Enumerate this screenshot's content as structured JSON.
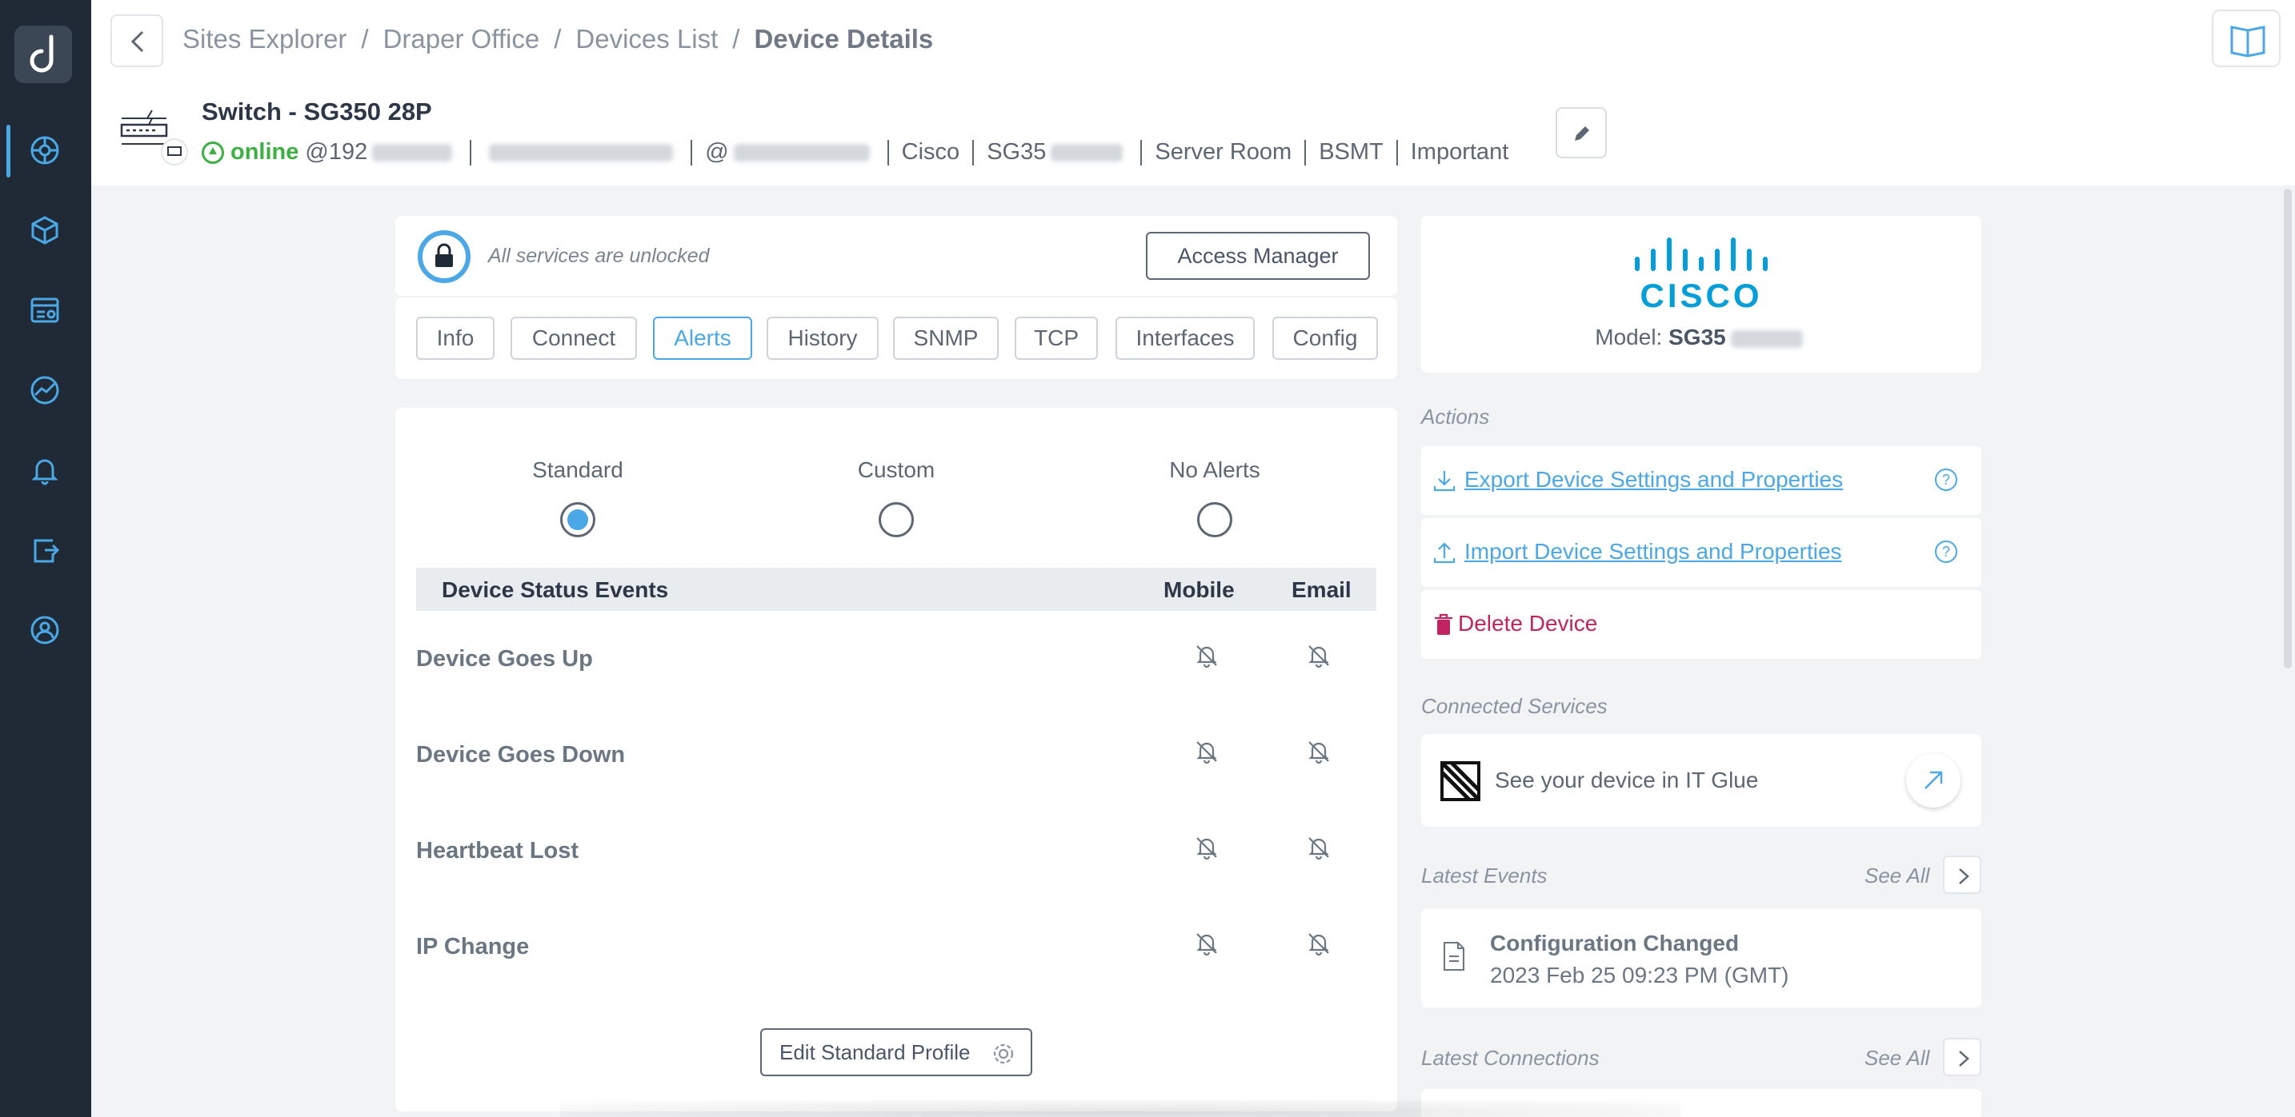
{
  "breadcrumb": {
    "items": [
      "Sites Explorer",
      "Draper Office",
      "Devices List"
    ],
    "current": "Device Details",
    "separator": "/"
  },
  "device": {
    "title": "Switch - SG350 28P",
    "status": "online",
    "ip_prefix": "@192",
    "at_prefix": "@",
    "vendor": "Cisco",
    "model_prefix": "SG35",
    "location": "Server Room",
    "floor": "BSMT",
    "tag": "Important"
  },
  "services": {
    "lock_text": "All services are unlocked",
    "access_manager": "Access Manager"
  },
  "tabs": [
    {
      "label": "Info",
      "active": false
    },
    {
      "label": "Connect",
      "active": false
    },
    {
      "label": "Alerts",
      "active": true
    },
    {
      "label": "History",
      "active": false
    },
    {
      "label": "SNMP",
      "active": false
    },
    {
      "label": "TCP",
      "active": false
    },
    {
      "label": "Interfaces",
      "active": false
    },
    {
      "label": "Config",
      "active": false
    }
  ],
  "alerts": {
    "profiles": [
      {
        "label": "Standard",
        "selected": true
      },
      {
        "label": "Custom",
        "selected": false
      },
      {
        "label": "No Alerts",
        "selected": false
      }
    ],
    "table_header": {
      "events": "Device Status Events",
      "mobile": "Mobile",
      "email": "Email"
    },
    "rows": [
      {
        "label": "Device Goes Up",
        "mobile": "bell-off-icon",
        "email": "bell-off-icon"
      },
      {
        "label": "Device Goes Down",
        "mobile": "bell-off-icon",
        "email": "bell-off-icon"
      },
      {
        "label": "Heartbeat Lost",
        "mobile": "bell-off-icon",
        "email": "bell-off-icon"
      },
      {
        "label": "IP Change",
        "mobile": "bell-off-icon",
        "email": "bell-off-icon"
      }
    ],
    "edit_profile": "Edit Standard Profile"
  },
  "vendor_card": {
    "logo_text": "CISCO",
    "model_label": "Model:",
    "model_value": "SG35"
  },
  "actions": {
    "title": "Actions",
    "export": "Export Device Settings and Properties",
    "import": "Import Device Settings and Properties",
    "delete": "Delete Device",
    "help_glyph": "?"
  },
  "connected_services": {
    "title": "Connected Services",
    "itglue": "See your device in IT Glue"
  },
  "latest_events": {
    "title": "Latest Events",
    "see_all": "See All",
    "event_title": "Configuration Changed",
    "event_time": "2023 Feb 25 09:23 PM (GMT)"
  },
  "latest_connections": {
    "title": "Latest Connections",
    "see_all": "See All"
  },
  "colors": {
    "accent": "#4aa8e6",
    "online": "#3cb043",
    "danger": "#c0245e",
    "nav_bg": "#1f2a36",
    "cisco_blue": "#049fd9"
  }
}
